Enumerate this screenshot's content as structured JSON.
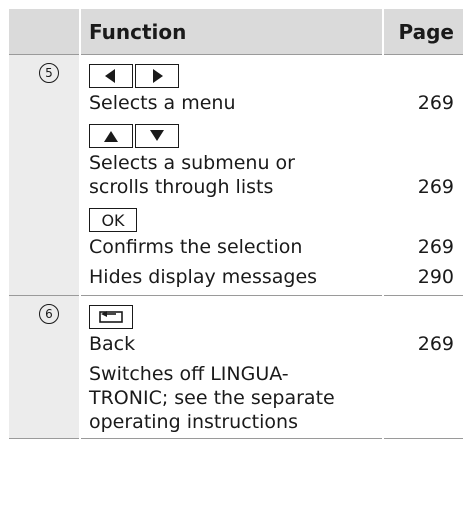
{
  "header": {
    "function_label": "Function",
    "page_label": "Page"
  },
  "groups": [
    {
      "number": "5",
      "entries": [
        {
          "keys": [
            "left-arrow-icon",
            "right-arrow-icon"
          ],
          "lines": [
            "Selects a menu"
          ],
          "page": "269"
        },
        {
          "keys": [
            "up-arrow-icon",
            "down-arrow-icon"
          ],
          "lines": [
            "Selects a submenu or",
            "scrolls through lists"
          ],
          "page": "269"
        },
        {
          "keys": [
            "ok-key"
          ],
          "key_label": "OK",
          "lines": [
            "Confirms the selection"
          ],
          "page": "269"
        },
        {
          "keys": [],
          "lines": [
            "Hides display messages"
          ],
          "page": "290"
        }
      ]
    },
    {
      "number": "6",
      "entries": [
        {
          "keys": [
            "back-icon"
          ],
          "lines": [
            "Back"
          ],
          "page": "269"
        },
        {
          "keys": [],
          "lines": [
            "Switches off LINGUA-",
            "TRONIC; see the separate",
            "operating instructions"
          ],
          "page": ""
        }
      ]
    }
  ]
}
